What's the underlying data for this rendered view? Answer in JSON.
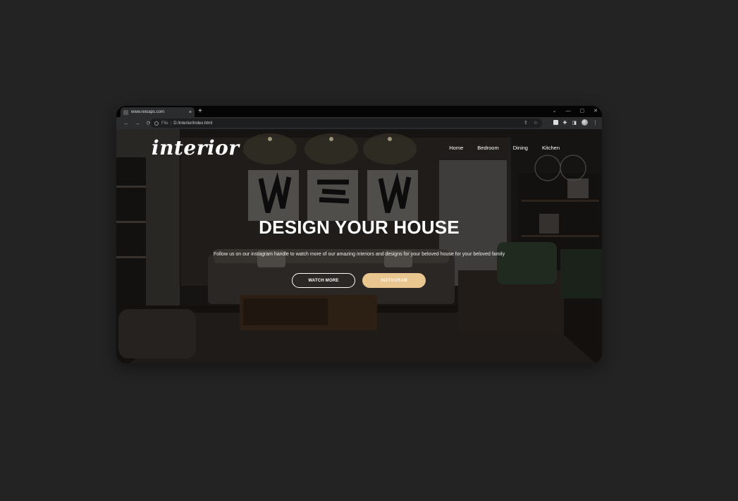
{
  "browser": {
    "tab_title": "www.reloaps.com",
    "tab_close": "×",
    "new_tab": "+",
    "window_controls": [
      "⌄",
      "—",
      "▢",
      "✕"
    ],
    "address": {
      "scheme": "File",
      "separator": "|",
      "url": "D:/interior/index.html"
    },
    "nav_icons": [
      "back-arrow-icon",
      "forward-arrow-icon",
      "reload-icon"
    ]
  },
  "site": {
    "logo": "interior",
    "nav": [
      "Home",
      "Bedroom",
      "Dining",
      "Kitchen"
    ],
    "hero": {
      "title": "DESIGN YOUR HOUSE",
      "subtitle": "Follow us on our instagram handle to watch more of our amazing interiors and designs for your beloved house for your beloved family",
      "watch_more": "WATCH MORE",
      "instagram": "INSTAGRAM"
    }
  },
  "colors": {
    "page_bg": "#232323",
    "accent": "#e9c58f"
  }
}
